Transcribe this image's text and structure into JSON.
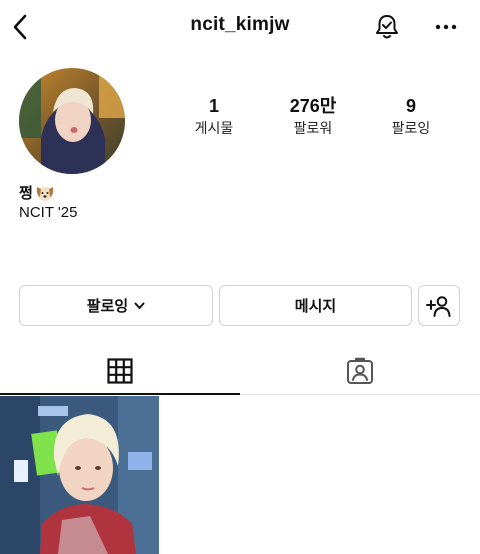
{
  "header": {
    "username": "ncit_kimjw",
    "back_icon": "chevron-left-icon",
    "notify_icon": "bell-check-icon",
    "more_icon": "more-horizontal-icon"
  },
  "profile": {
    "avatar": "profile-photo",
    "stats": [
      {
        "value": "1",
        "label": "게시물"
      },
      {
        "value": "276만",
        "label": "팔로워"
      },
      {
        "value": "9",
        "label": "팔로잉"
      }
    ],
    "name": "쩡",
    "name_emoji": "dog-face-icon",
    "bio": "NCIT '25"
  },
  "actions": {
    "following_label": "팔로잉",
    "following_icon": "chevron-down-icon",
    "message_label": "메시지",
    "add_user_icon": "add-user-icon"
  },
  "tabs": [
    {
      "icon": "grid-icon",
      "active": true
    },
    {
      "icon": "tagged-person-icon",
      "active": false
    }
  ],
  "posts": [
    {
      "type": "photo"
    }
  ]
}
